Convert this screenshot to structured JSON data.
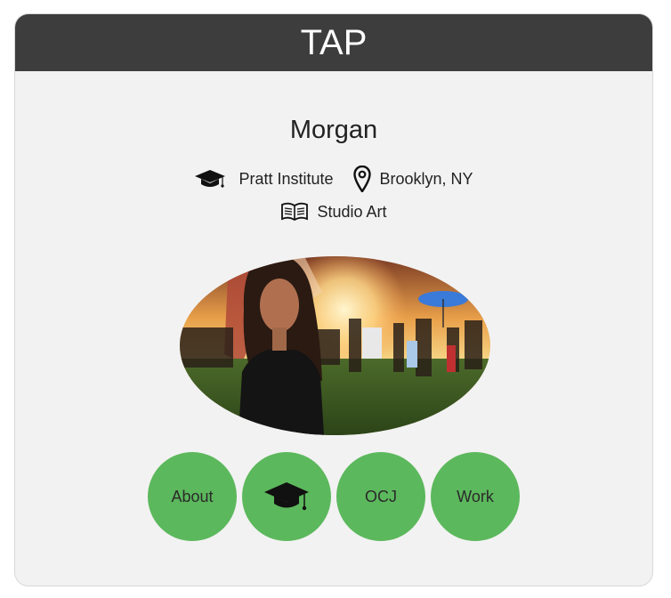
{
  "header": {
    "title": "TAP"
  },
  "profile": {
    "name": "Morgan",
    "school": "Pratt Institute",
    "location": "Brooklyn, NY",
    "major": "Studio Art"
  },
  "icons": {
    "school": "graduation-cap-icon",
    "location": "map-pin-icon",
    "major": "open-book-icon"
  },
  "nav": {
    "items": [
      {
        "label": "About",
        "icon": null
      },
      {
        "label": "",
        "icon": "graduation-cap-icon"
      },
      {
        "label": "OCJ",
        "icon": null
      },
      {
        "label": "Work",
        "icon": null
      }
    ]
  },
  "colors": {
    "header_bg": "#3d3d3d",
    "card_bg": "#f2f2f2",
    "nav_button": "#5cb85c"
  }
}
